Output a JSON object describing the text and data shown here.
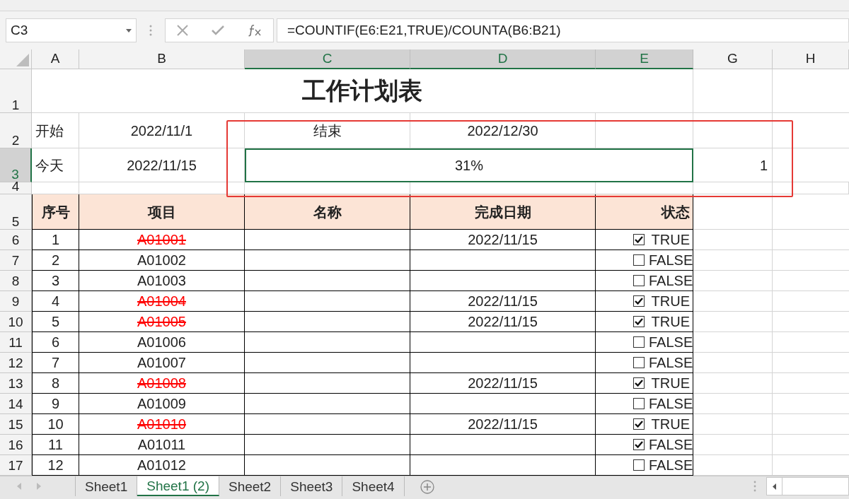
{
  "name_box": {
    "value": "C3"
  },
  "formula_bar": {
    "formula": "=COUNTIF(E6:E21,TRUE)/COUNTA(B6:B21)"
  },
  "column_headers": [
    {
      "label": "A",
      "selected": false
    },
    {
      "label": "B",
      "selected": false
    },
    {
      "label": "C",
      "selected": true
    },
    {
      "label": "D",
      "selected": true
    },
    {
      "label": "E",
      "selected": true
    },
    {
      "label": "G",
      "selected": false
    },
    {
      "label": "H",
      "selected": false
    }
  ],
  "row_headers": [
    {
      "label": "1",
      "selected": false
    },
    {
      "label": "2",
      "selected": false
    },
    {
      "label": "3",
      "selected": true
    },
    {
      "label": "4",
      "selected": false
    },
    {
      "label": "5",
      "selected": false
    }
  ],
  "title": "工作计划表",
  "start": {
    "label": "开始",
    "date": "2022/11/1"
  },
  "end": {
    "label": "结束",
    "date": "2022/12/30"
  },
  "today": {
    "label": "今天",
    "date": "2022/11/15"
  },
  "progress": {
    "value": "31%",
    "selected": true
  },
  "g3": "1",
  "table": {
    "columns": [
      "序号",
      "项目",
      "名称",
      "完成日期",
      "状态"
    ],
    "rows": [
      {
        "row": "6",
        "no": "1",
        "item": "A01001",
        "struck": true,
        "date": "2022/11/15",
        "checked": true,
        "state": "TRUE"
      },
      {
        "row": "7",
        "no": "2",
        "item": "A01002",
        "struck": false,
        "checked": false,
        "state": "FALSE"
      },
      {
        "row": "8",
        "no": "3",
        "item": "A01003",
        "struck": false,
        "checked": false,
        "state": "FALSE"
      },
      {
        "row": "9",
        "no": "4",
        "item": "A01004",
        "struck": true,
        "date": "2022/11/15",
        "checked": true,
        "state": "TRUE"
      },
      {
        "row": "10",
        "no": "5",
        "item": "A01005",
        "struck": true,
        "date": "2022/11/15",
        "checked": true,
        "state": "TRUE"
      },
      {
        "row": "11",
        "no": "6",
        "item": "A01006",
        "struck": false,
        "checked": false,
        "state": "FALSE"
      },
      {
        "row": "12",
        "no": "7",
        "item": "A01007",
        "struck": false,
        "checked": false,
        "state": "FALSE"
      },
      {
        "row": "13",
        "no": "8",
        "item": "A01008",
        "struck": true,
        "date": "2022/11/15",
        "checked": true,
        "state": "TRUE"
      },
      {
        "row": "14",
        "no": "9",
        "item": "A01009",
        "struck": false,
        "checked": false,
        "state": "FALSE"
      },
      {
        "row": "15",
        "no": "10",
        "item": "A01010",
        "struck": true,
        "date": "2022/11/15",
        "checked": true,
        "state": "TRUE"
      },
      {
        "row": "16",
        "no": "11",
        "item": "A01011",
        "struck": false,
        "checked": true,
        "state": "FALSE"
      },
      {
        "row": "17",
        "no": "12",
        "item": "A01012",
        "struck": false,
        "checked": false,
        "state": "FALSE"
      }
    ]
  },
  "sheet_tabs": [
    {
      "label": "Sheet1",
      "selected": false
    },
    {
      "label": "Sheet1 (2)",
      "selected": true
    },
    {
      "label": "Sheet2",
      "selected": false
    },
    {
      "label": "Sheet3",
      "selected": false
    },
    {
      "label": "Sheet4",
      "selected": false
    }
  ]
}
